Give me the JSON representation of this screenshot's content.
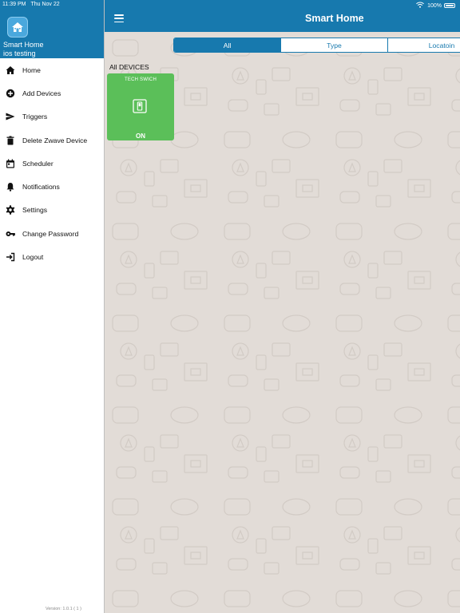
{
  "status_bar": {
    "time": "11:39 PM",
    "date": "Thu Nov 22",
    "battery": "100%"
  },
  "app": {
    "title": "Smart Home"
  },
  "sidebar": {
    "app_name": "Smart Home",
    "user": "ios testing",
    "items": [
      {
        "label": "Home",
        "icon": "home-icon"
      },
      {
        "label": "Add Devices",
        "icon": "add-circle-icon"
      },
      {
        "label": "Triggers",
        "icon": "send-icon"
      },
      {
        "label": "Delete Zwave Device",
        "icon": "trash-icon"
      },
      {
        "label": "Scheduler",
        "icon": "calendar-icon"
      },
      {
        "label": "Notifications",
        "icon": "bell-icon"
      },
      {
        "label": "Settings",
        "icon": "gear-icon"
      },
      {
        "label": "Change Password",
        "icon": "key-icon"
      },
      {
        "label": "Logout",
        "icon": "logout-icon"
      }
    ],
    "version": "Version: 1.0.1 ( 1 )"
  },
  "tabs": [
    {
      "label": "All",
      "active": true
    },
    {
      "label": "Type",
      "active": false
    },
    {
      "label": "Locatoin",
      "active": false
    }
  ],
  "section_title": "All DEVICES",
  "devices": [
    {
      "name": "TECH SWICH",
      "state": "ON",
      "icon": "switch-icon"
    }
  ],
  "colors": {
    "primary": "#1779ae",
    "device_on": "#5bbf59",
    "background": "#e2dcd7"
  }
}
